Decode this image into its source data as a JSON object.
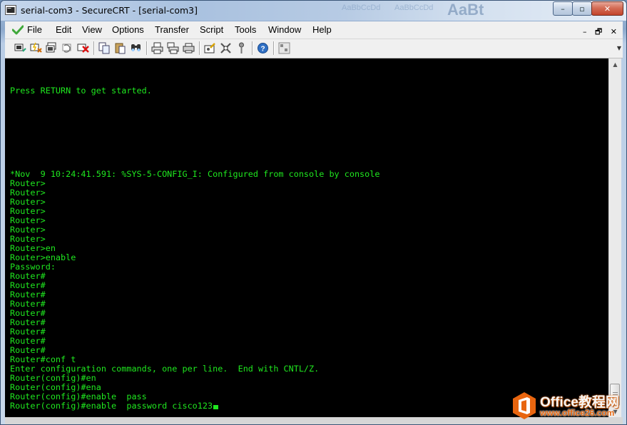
{
  "window": {
    "title": "serial-com3 - SecureCRT - [serial-com3]",
    "caption_buttons": {
      "minimize": "–",
      "maximize": "▫",
      "close": "✕"
    }
  },
  "background_ghost_text": [
    "AaBbCcDd",
    "AaBbCcDd",
    "AaBt"
  ],
  "menu": {
    "items": [
      "File",
      "Edit",
      "View",
      "Options",
      "Transfer",
      "Script",
      "Tools",
      "Window",
      "Help"
    ],
    "mdi_buttons": [
      "–",
      "🗗",
      "✕"
    ]
  },
  "toolbar": {
    "icons": [
      "connect-icon",
      "quick-connect-icon",
      "connect-tab-icon",
      "reconnect-icon",
      "disconnect-icon",
      "copy-icon",
      "paste-icon",
      "find-icon",
      "print-icon",
      "print-selection-icon",
      "print-setup-icon",
      "session-options-icon",
      "global-options-icon",
      "key-icon",
      "help-icon",
      "keymap-icon"
    ]
  },
  "terminal": {
    "colors": {
      "background": "#000000",
      "text": "#1fe81f"
    },
    "lines": [
      {
        "row": 3,
        "text": "Press RETURN to get started."
      },
      {
        "row": 12,
        "text": "*Nov  9 10:24:41.591: %SYS-5-CONFIG_I: Configured from console by console"
      },
      {
        "row": 13,
        "text": "Router>"
      },
      {
        "row": 14,
        "text": "Router>"
      },
      {
        "row": 15,
        "text": "Router>"
      },
      {
        "row": 16,
        "text": "Router>"
      },
      {
        "row": 17,
        "text": "Router>"
      },
      {
        "row": 18,
        "text": "Router>"
      },
      {
        "row": 19,
        "text": "Router>"
      },
      {
        "row": 20,
        "text": "Router>en"
      },
      {
        "row": 21,
        "text": "Router>enable"
      },
      {
        "row": 22,
        "text": "Password:"
      },
      {
        "row": 23,
        "text": "Router#"
      },
      {
        "row": 24,
        "text": "Router#"
      },
      {
        "row": 25,
        "text": "Router#"
      },
      {
        "row": 26,
        "text": "Router#"
      },
      {
        "row": 27,
        "text": "Router#"
      },
      {
        "row": 28,
        "text": "Router#"
      },
      {
        "row": 29,
        "text": "Router#"
      },
      {
        "row": 30,
        "text": "Router#"
      },
      {
        "row": 31,
        "text": "Router#"
      },
      {
        "row": 32,
        "text": "Router#conf t"
      },
      {
        "row": 33,
        "text": "Enter configuration commands, one per line.  End with CNTL/Z."
      },
      {
        "row": 34,
        "text": "Router(config)#en"
      },
      {
        "row": 35,
        "text": "Router(config)#ena"
      },
      {
        "row": 36,
        "text": "Router(config)#enable  pass"
      },
      {
        "row": 37,
        "text": "Router(config)#enable  password cisco123"
      }
    ]
  },
  "watermark": {
    "brand": "Office",
    "brand_cn": "教程网",
    "url": "www.office26.com"
  }
}
